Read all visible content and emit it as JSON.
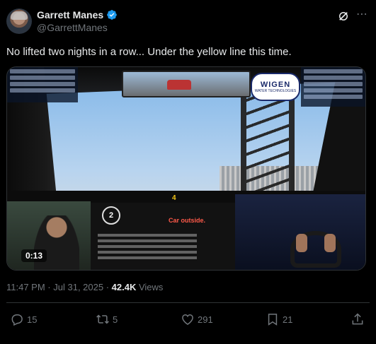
{
  "author": {
    "display_name": "Garrett Manes",
    "handle": "@GarrettManes",
    "verified": true
  },
  "tweet": {
    "text": "No lifted two nights in a row... Under the yellow line this time."
  },
  "media": {
    "duration": "0:13",
    "sponsor_name": "WIGEN",
    "sponsor_sub": "WATER TECHNOLOGIES",
    "hud_gear": "2",
    "hud_speed": "4",
    "hud_message": "Car outside."
  },
  "meta": {
    "time": "11:47 PM",
    "separator": " · ",
    "date": "Jul 31, 2025",
    "views_count": "42.4K",
    "views_label": " Views"
  },
  "actions": {
    "replies": "15",
    "reposts": "5",
    "likes": "291",
    "bookmarks": "21"
  },
  "colors": {
    "background": "#000000",
    "text": "#e7e9ea",
    "muted": "#71767b",
    "verified": "#1d9bf0",
    "divider": "#2f3336"
  },
  "icons": [
    "grok-icon",
    "more-icon",
    "verified-badge-icon",
    "reply-icon",
    "repost-icon",
    "like-icon",
    "bookmark-icon",
    "share-icon"
  ]
}
